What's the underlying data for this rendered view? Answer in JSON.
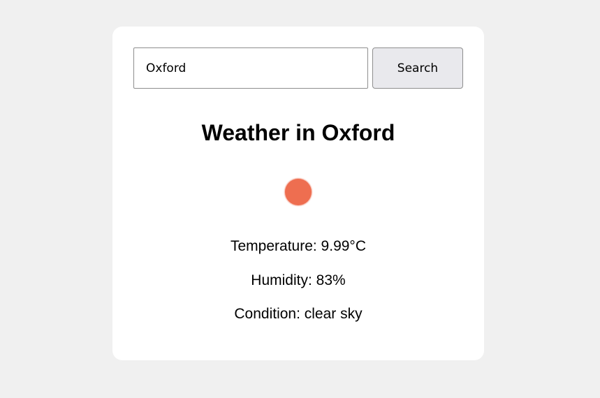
{
  "search": {
    "value": "Oxford",
    "button_label": "Search"
  },
  "weather": {
    "title": "Weather in Oxford",
    "icon": "sun-icon",
    "icon_color": "#ee6e50",
    "temperature": "Temperature: 9.99°C",
    "humidity": "Humidity: 83%",
    "condition": "Condition: clear sky"
  }
}
